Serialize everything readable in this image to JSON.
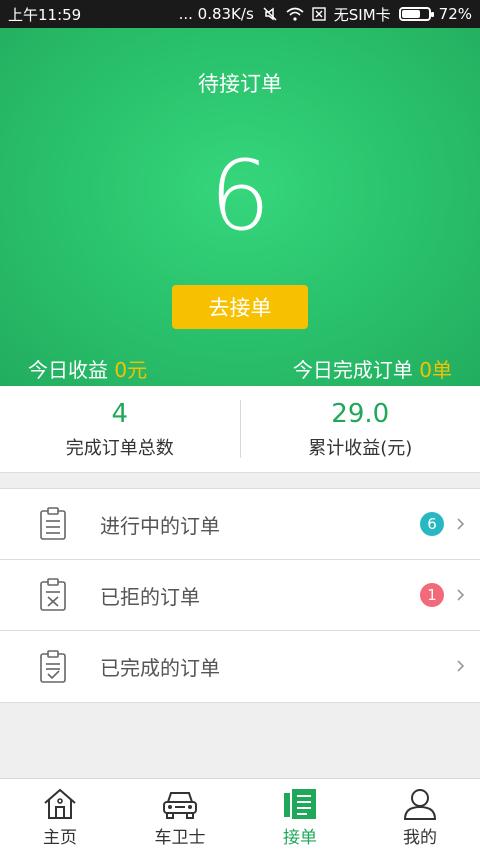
{
  "statusbar": {
    "time": "上午11:59",
    "speed": "... 0.83K/s",
    "sim": "无SIM卡",
    "battery": "72%",
    "battery_level": 0.72
  },
  "hero": {
    "title": "待接订单",
    "count": "6",
    "accept_label": "去接单",
    "today_income_label": "今日收益",
    "today_income_value": "0元",
    "today_done_label": "今日完成订单",
    "today_done_value": "0单"
  },
  "summary": {
    "total_done_value": "4",
    "total_done_label": "完成订单总数",
    "total_income_value": "29.0",
    "total_income_label": "累计收益(元)"
  },
  "orders": {
    "items": [
      {
        "label": "进行中的订单",
        "badge": "6",
        "badge_color": "#27b8c2",
        "icon": "clipboard-list-icon"
      },
      {
        "label": "已拒的订单",
        "badge": "1",
        "badge_color": "#f2697a",
        "icon": "clipboard-x-icon"
      },
      {
        "label": "已完成的订单",
        "badge": "",
        "badge_color": "",
        "icon": "clipboard-check-icon"
      }
    ]
  },
  "tabs": [
    {
      "label": "主页",
      "icon": "home-icon",
      "active": false
    },
    {
      "label": "车卫士",
      "icon": "car-icon",
      "active": false
    },
    {
      "label": "接单",
      "icon": "orders-icon",
      "active": true
    },
    {
      "label": "我的",
      "icon": "user-icon",
      "active": false
    }
  ],
  "colors": {
    "accent_green": "#1fa85a",
    "hero_green": "#2bc46e",
    "button_yellow": "#f7c000"
  }
}
